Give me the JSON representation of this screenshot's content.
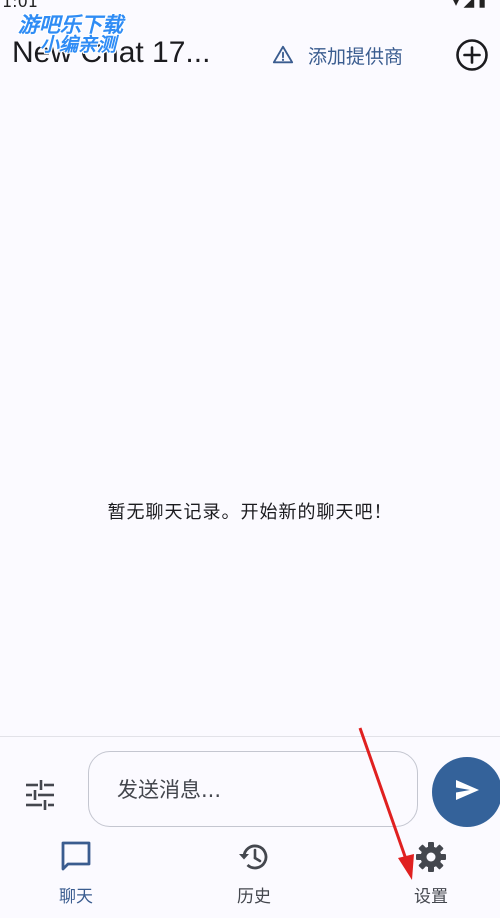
{
  "status_bar": {
    "time": "1:01",
    "icons": "▾◢▮"
  },
  "watermark": {
    "line1": "游吧乐下载",
    "line2": "小编亲测"
  },
  "app_bar": {
    "title": "New Chat 17...",
    "add_provider_label": "添加提供商",
    "icons": {
      "warning": "warning-triangle-icon",
      "new_chat": "add-circle-icon"
    }
  },
  "chat": {
    "empty_message": "暂无聊天记录。开始新的聊天吧！"
  },
  "composer": {
    "placeholder": "发送消息...",
    "icons": {
      "options": "tune-sliders-icon",
      "send": "send-icon"
    }
  },
  "bottom_nav": {
    "items": [
      {
        "label": "聊天",
        "icon": "chat-bubble-icon",
        "selected": true
      },
      {
        "label": "历史",
        "icon": "history-icon",
        "selected": false
      },
      {
        "label": "设置",
        "icon": "gear-icon",
        "selected": false
      }
    ]
  },
  "colors": {
    "accent": "#3a5c8f",
    "send_button": "#34629a",
    "background": "#fbfaff",
    "annotation_arrow": "#e02020"
  }
}
